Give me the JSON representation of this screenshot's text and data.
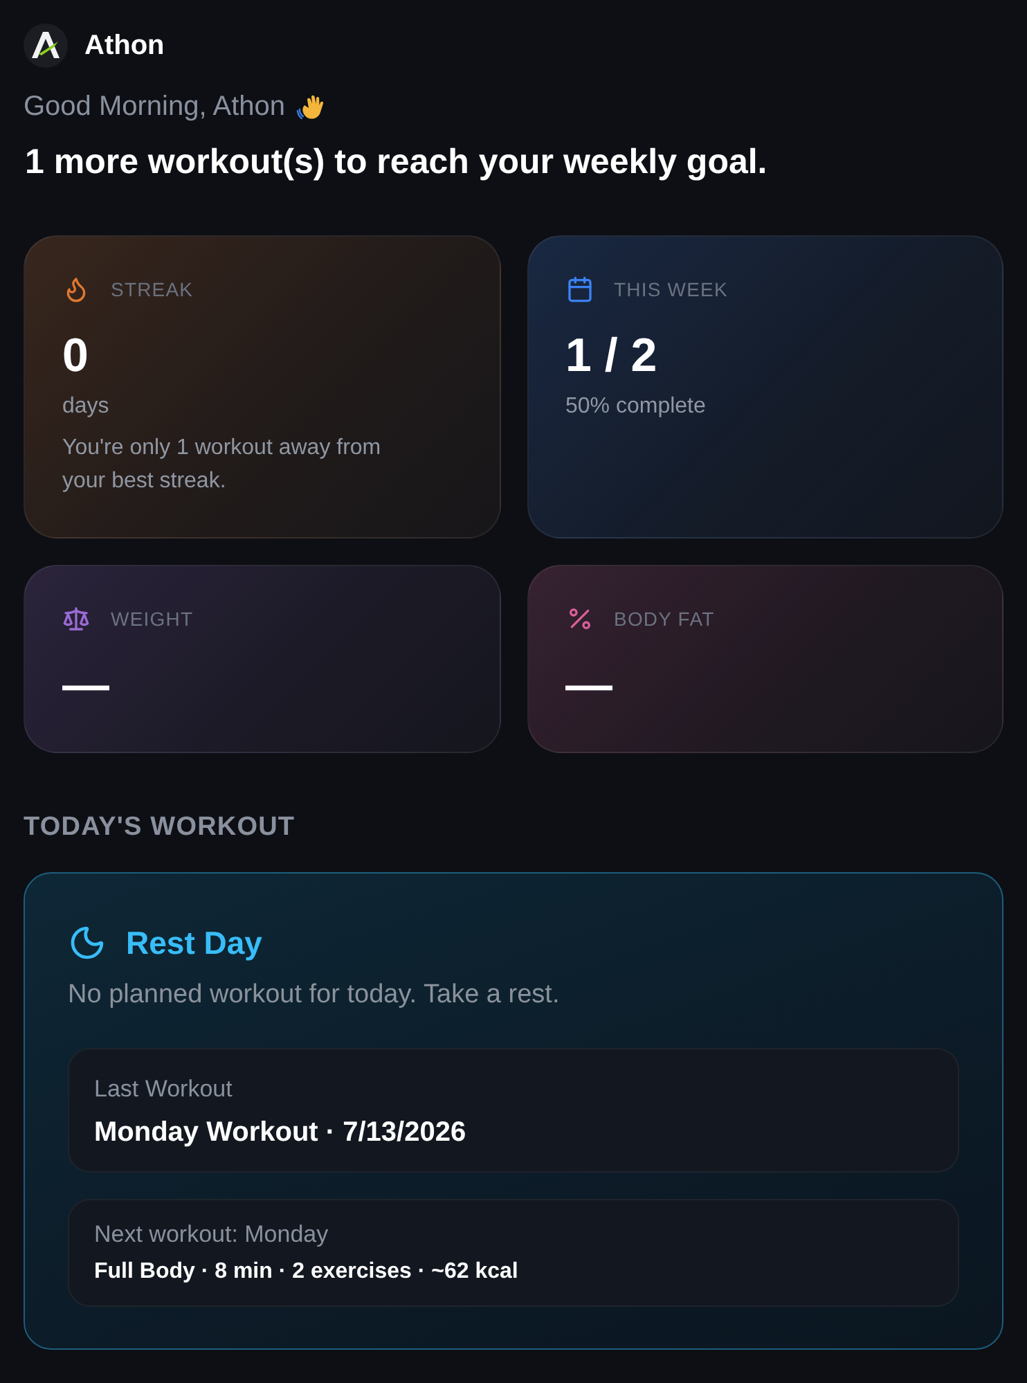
{
  "app": {
    "name": "Athon"
  },
  "greeting": "Good Morning, Athon",
  "headline": "1 more workout(s) to reach your weekly goal.",
  "stats": [
    {
      "kind": "streak",
      "label": "STREAK",
      "color": "#e0782f",
      "value": "0",
      "unit": "days",
      "note": "You're only 1 workout away from your best streak."
    },
    {
      "kind": "week",
      "label": "THIS WEEK",
      "color": "#3b82f6",
      "value": "1 / 2",
      "unit": "50% complete"
    },
    {
      "kind": "weight",
      "label": "WEIGHT",
      "color": "#9b6bd6",
      "value": "—"
    },
    {
      "kind": "body_fat",
      "label": "BODY FAT",
      "color": "#d9609a",
      "value": "—"
    }
  ],
  "todays_workout": {
    "heading": "TODAY'S WORKOUT",
    "title": "Rest Day",
    "description": "No planned workout for today. Take a rest.",
    "last": {
      "label": "Last Workout",
      "value": "Monday Workout · 7/13/2026"
    },
    "next": {
      "label": "Next workout: Monday",
      "value": "Full Body · 8 min · 2 exercises · ~62 kcal"
    }
  }
}
